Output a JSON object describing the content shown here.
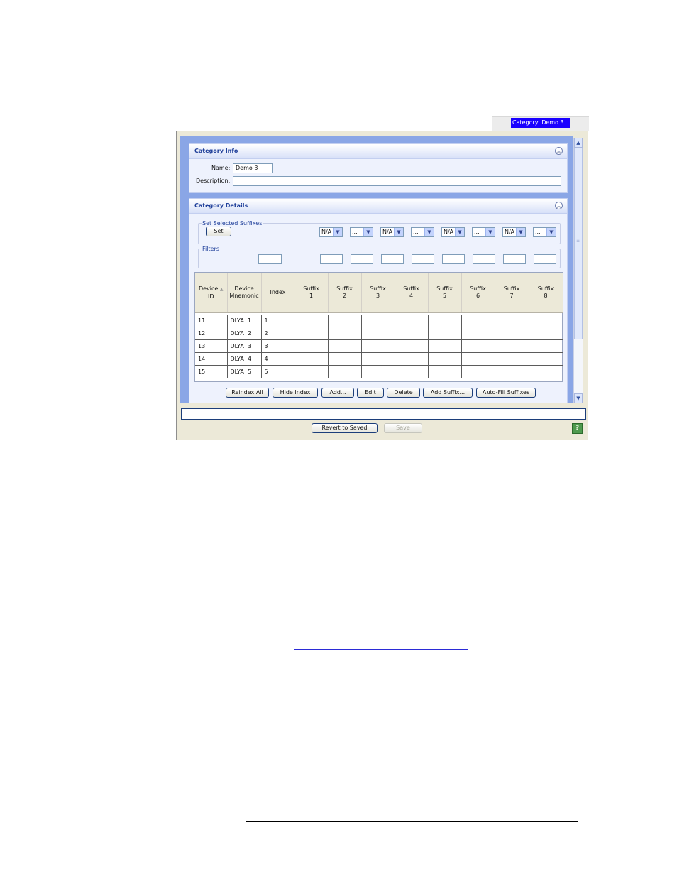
{
  "category_tab": {
    "label": "Category: Demo 3"
  },
  "category_info": {
    "title": "Category Info",
    "name_label": "Name:",
    "name_value": "Demo 3",
    "description_label": "Description:",
    "description_value": ""
  },
  "category_details": {
    "title": "Category Details",
    "set_group": {
      "title": "Set Selected Suffixes",
      "set_label": "Set",
      "dropdowns": [
        "N/A",
        "...",
        "N/A",
        "...",
        "N/A",
        "...",
        "N/A",
        "..."
      ]
    },
    "filters": {
      "title": "Filters"
    },
    "table": {
      "headers": [
        [
          "Device",
          "ID"
        ],
        [
          "Device",
          "Mnemonic"
        ],
        [
          "Index",
          ""
        ],
        [
          "Suffix",
          "1"
        ],
        [
          "Suffix",
          "2"
        ],
        [
          "Suffix",
          "3"
        ],
        [
          "Suffix",
          "4"
        ],
        [
          "Suffix",
          "5"
        ],
        [
          "Suffix",
          "6"
        ],
        [
          "Suffix",
          "7"
        ],
        [
          "Suffix",
          "8"
        ]
      ],
      "rows": [
        {
          "id": "11",
          "mnemonic": "DLYA  1",
          "index": "1"
        },
        {
          "id": "12",
          "mnemonic": "DLYA  2",
          "index": "2"
        },
        {
          "id": "13",
          "mnemonic": "DLYA  3",
          "index": "3"
        },
        {
          "id": "14",
          "mnemonic": "DLYA  4",
          "index": "4"
        },
        {
          "id": "15",
          "mnemonic": "DLYA  5",
          "index": "5"
        }
      ]
    },
    "buttons": {
      "reindex_all": "Reindex All",
      "hide_index": "Hide Index",
      "add": "Add...",
      "edit": "Edit",
      "delete": "Delete",
      "add_suffix": "Add Suffix...",
      "auto_fill": "Auto-Fill Suffixes"
    }
  },
  "footer_buttons": {
    "revert": "Revert to Saved",
    "save": "Save"
  },
  "icons": {
    "collapse": "double-chevron-up-icon",
    "help": "help-icon",
    "sort": "sort-ascending-icon"
  }
}
